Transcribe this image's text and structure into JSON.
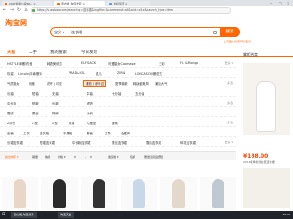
{
  "browser": {
    "tabs": [
      {
        "label": "2017最新小说60... ×"
      },
      {
        "label": "连衣裙_淘宝搜索 ×"
      },
      {
        "label": "新标签页 ×"
      }
    ],
    "url": "https://s.taobao.com/search?q=连衣裙&imgfile=&commend=all&ssid=s5-e&search_type=item",
    "nav": {
      "back": "←",
      "forward": "→",
      "reload": "↻",
      "home": "⌂"
    },
    "window_controls": {
      "min": "–",
      "max": "□",
      "close": "×"
    }
  },
  "header": {
    "logo": "淘宝网",
    "search": {
      "type": "宝贝 ▾",
      "value": "连衣裙",
      "button": "搜索"
    },
    "sub_link": "上传图片搜索同款宝贝"
  },
  "category_nav": [
    "天猫",
    "二手",
    "我的搜索",
    "今日发现"
  ],
  "attribute_rows": [
    {
      "cells": [
        "HSTYLE/韩都衣舍",
        "韩语美依恋",
        "ELF SACK",
        "可爱猫女Coomaste",
        "三彩",
        "Fr. & Mongo"
      ],
      "more": "更多 ▾"
    },
    {
      "cells": [
        "玖姿",
        "Lincoln/林肯服饰",
        "PRADA.IOL",
        "鼠儿",
        "ZIRIN",
        "LONCASCH/朗佐达"
      ],
      "more": ""
    },
    {
      "cells": [
        "气质淑女",
        "优雅",
        "花卉 / 印花",
        "通勤 / 荷叶边",
        "夏季新款",
        "韩版欧美风",
        "潮流大气"
      ],
      "more": "多选"
    },
    {
      "cells": [
        "长袖",
        "短袖",
        "无袖",
        "中袖",
        "七分袖",
        "五分袖"
      ],
      "more": ""
    },
    {
      "cells": [
        "中长款",
        "短款",
        "长款",
        "超短"
      ],
      "more": "多选"
    },
    {
      "cells": [
        "雪纺",
        "蕾丝",
        "棉麻",
        "针织"
      ],
      "more": ""
    },
    {
      "cells": [
        "A字型",
        "H型",
        "X型",
        "修身",
        "大摆型",
        "直筒"
      ],
      "more": "多选"
    },
    {
      "cells": [
        "童装",
        "上衣",
        "连衣裙",
        "半身裙",
        "套装",
        "日系",
        "名媛风"
      ],
      "more": ""
    },
    {
      "cells": [
        "长裙连衣裙",
        "短裙连衣裙",
        "中长款连衣裙",
        "蕾丝连衣裙",
        "雪纺连衣裙",
        "碎花连衣裙"
      ],
      "more": "更多 ▾"
    }
  ],
  "sort_bar": [
    "综合排序 ▾",
    "销量",
    "信用",
    "价格 ▾",
    "¥",
    "-",
    "¥",
    "发货地 ▾",
    "包邮",
    "赠送退货运费险"
  ],
  "right_ad": {
    "title": "掌柜热卖",
    "price": "¥188.00",
    "desc": "2018夏季新款女装连衣裙"
  },
  "taskbar": {
    "start": "⊞",
    "tasks": [
      "连衣裙_淘宝搜索",
      "淘宝天猫"
    ],
    "clock": "16:28"
  }
}
